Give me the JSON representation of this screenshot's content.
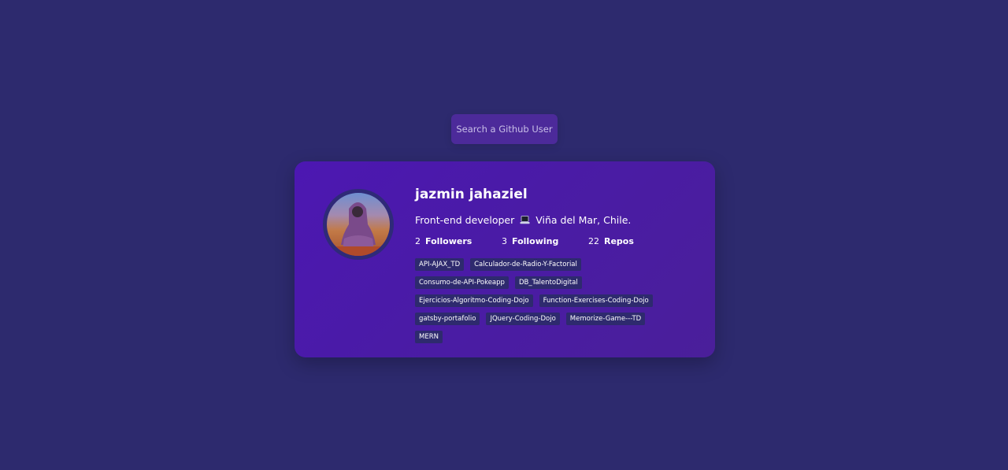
{
  "search": {
    "placeholder": "Search a Github User"
  },
  "profile": {
    "name": "jazmin jahaziel",
    "bio_before": "Front-end developer",
    "bio_icon": "laptop-icon",
    "bio_after": "Viña del Mar, Chile.",
    "stats": {
      "followers": {
        "count": "2",
        "label": "Followers"
      },
      "following": {
        "count": "3",
        "label": "Following"
      },
      "repos": {
        "count": "22",
        "label": "Repos"
      }
    },
    "repositories": [
      "API-AJAX_TD",
      "Calculador-de-Radio-Y-Factorial",
      "Consumo-de-API-Pokeapp",
      "DB_TalentoDigital",
      "Ejercicios-Algoritmo-Coding-Dojo",
      "Function-Exercises-Coding-Dojo",
      "gatsby-portafolio",
      "JQuery-Coding-Dojo",
      "Memorize-Game---TD",
      "MERN"
    ]
  },
  "colors": {
    "background": "#2d2a6e",
    "card": "#4c17b2",
    "search": "#4c2a9a",
    "repo_tag": "#2e2a6e"
  }
}
